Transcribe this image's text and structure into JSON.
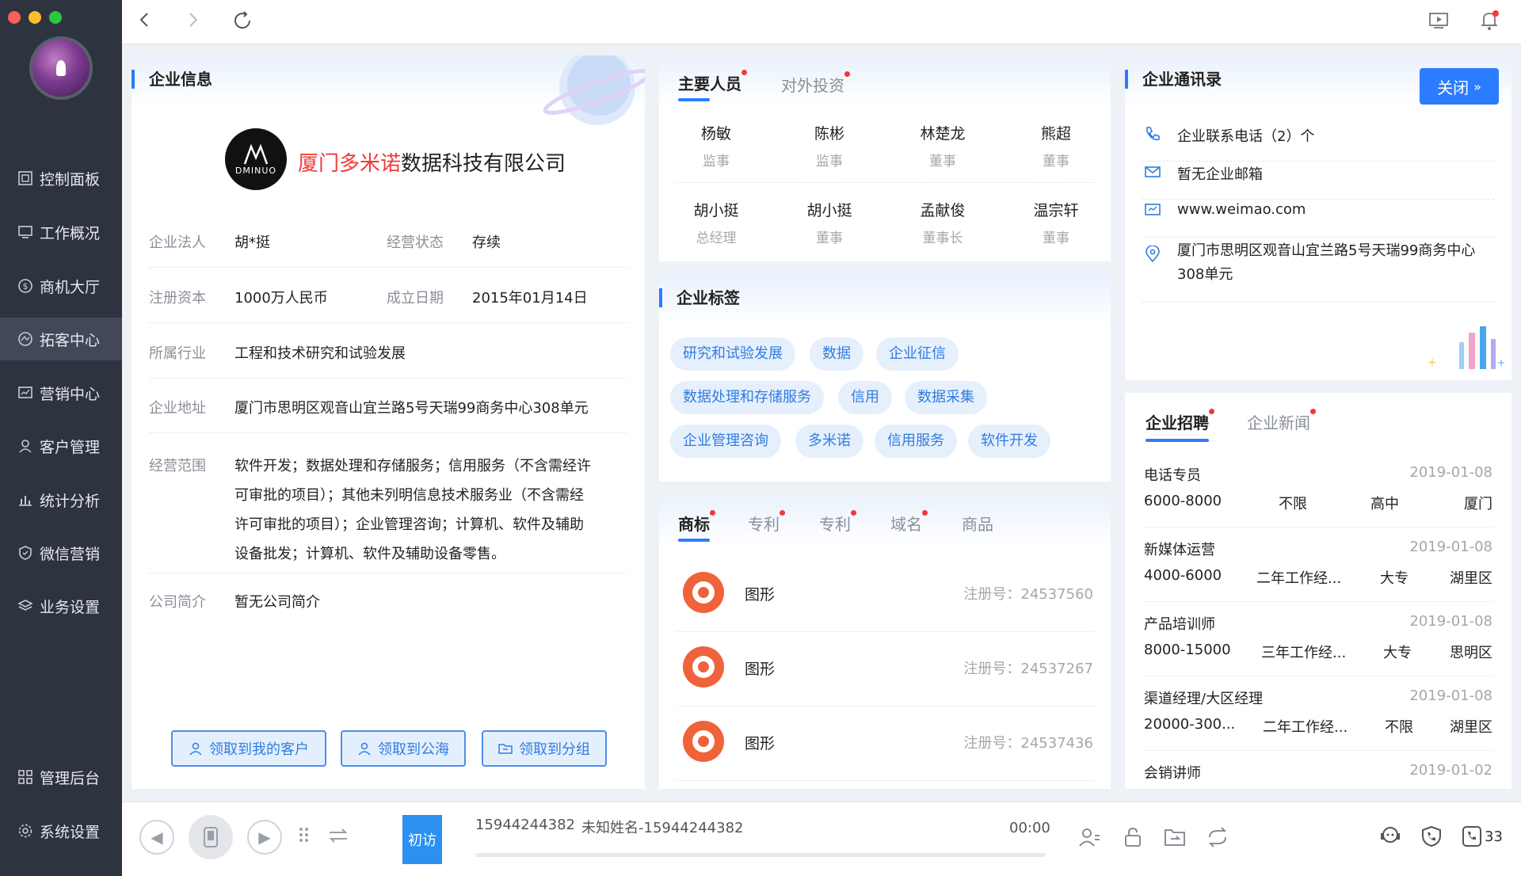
{
  "colors": {
    "accent": "#2b7cff",
    "sidebar": "#2e3340",
    "red": "#f03a3a"
  },
  "sidebar": {
    "items": [
      {
        "label": "控制面板",
        "icon": "dashboard-icon"
      },
      {
        "label": "工作概况",
        "icon": "monitor-icon"
      },
      {
        "label": "商机大厅",
        "icon": "dollar-icon"
      },
      {
        "label": "拓客中心",
        "icon": "network-icon"
      },
      {
        "label": "营销中心",
        "icon": "chart-icon"
      },
      {
        "label": "客户管理",
        "icon": "user-icon"
      },
      {
        "label": "统计分析",
        "icon": "bar-chart-icon"
      },
      {
        "label": "微信营销",
        "icon": "shield-icon"
      },
      {
        "label": "业务设置",
        "icon": "layers-icon"
      }
    ],
    "bottom_items": [
      {
        "label": "管理后台",
        "icon": "grid-icon"
      },
      {
        "label": "系统设置",
        "icon": "gear-icon"
      }
    ]
  },
  "company": {
    "title": "企业信息",
    "logo_text": "DMINUO",
    "name_highlight": "厦门多米诺",
    "name_rest": "数据科技有限公司",
    "legal_label": "企业法人",
    "legal": "胡*挺",
    "status_label": "经营状态",
    "status": "存续",
    "capital_label": "注册资本",
    "capital": "1000万人民币",
    "founded_label": "成立日期",
    "founded": "2015年01月14日",
    "industry_label": "所属行业",
    "industry": "工程和技术研究和试验发展",
    "address_label": "企业地址",
    "address": "厦门市思明区观音山宜兰路5号天瑞99商务中心308单元",
    "scope_label": "经营范围",
    "scope_lines": [
      "软件开发；数据处理和存储服务；信用服务（不含需经许",
      "可审批的项目）；其他未列明信息技术服务业（不含需经",
      "许可审批的项目）；企业管理咨询；计算机、软件及辅助",
      "设备批发；计算机、软件及辅助设备零售。"
    ],
    "intro_label": "公司简介",
    "intro": "暂无公司简介",
    "btn_my": "领取到我的客户",
    "btn_sea": "领取到公海",
    "btn_group": "领取到分组"
  },
  "people": {
    "tab_main": "主要人员",
    "tab_invest": "对外投资",
    "list": [
      {
        "name": "杨敏",
        "role": "监事"
      },
      {
        "name": "陈彬",
        "role": "监事"
      },
      {
        "name": "林楚龙",
        "role": "董事"
      },
      {
        "name": "熊超",
        "role": "董事"
      },
      {
        "name": "胡小挺",
        "role": "总经理"
      },
      {
        "name": "胡小挺",
        "role": "董事"
      },
      {
        "name": "孟献俊",
        "role": "董事长"
      },
      {
        "name": "温宗轩",
        "role": "董事"
      }
    ]
  },
  "tags": {
    "title": "企业标签",
    "list": [
      "研究和试验发展",
      "数据",
      "企业征信",
      "数据处理和存储服务",
      "信用",
      "数据采集",
      "企业管理咨询",
      "多米诺",
      "信用服务",
      "软件开发"
    ]
  },
  "ip": {
    "tabs": [
      "商标",
      "专利",
      "专利",
      "域名",
      "商品"
    ],
    "list": [
      {
        "name": "图形",
        "no": "注册号：24537560"
      },
      {
        "name": "图形",
        "no": "注册号：24537267"
      },
      {
        "name": "图形",
        "no": "注册号：24537436"
      }
    ]
  },
  "contacts": {
    "title": "企业通讯录",
    "close": "关闭",
    "phone": "企业联系电话（2）个",
    "email": "暂无企业邮箱",
    "website": "www.weimao.com",
    "address_line1": "厦门市思明区观音山宜兰路5号天瑞99商务中心",
    "address_line2": "308单元"
  },
  "jobs": {
    "tab_jobs": "企业招聘",
    "tab_news": "企业新闻",
    "list": [
      {
        "title": "电话专员",
        "date": "2019-01-08",
        "salary": "6000-8000",
        "exp": "不限",
        "edu": "高中",
        "area": "厦门"
      },
      {
        "title": "新媒体运营",
        "date": "2019-01-08",
        "salary": "4000-6000",
        "exp": "二年工作经...",
        "edu": "大专",
        "area": "湖里区"
      },
      {
        "title": "产品培训师",
        "date": "2019-01-08",
        "salary": "8000-15000",
        "exp": "三年工作经...",
        "edu": "大专",
        "area": "思明区"
      },
      {
        "title": "渠道经理/大区经理",
        "date": "2019-01-08",
        "salary": "20000-300...",
        "exp": "二年工作经...",
        "edu": "不限",
        "area": "湖里区"
      },
      {
        "title": "会销讲师",
        "date": "2019-01-02",
        "salary": "",
        "exp": "",
        "edu": "",
        "area": ""
      }
    ]
  },
  "call": {
    "visit_label": "初访",
    "number": "15944244382",
    "caller": "未知姓名-15944244382",
    "timer": "00:00",
    "count": "33"
  }
}
